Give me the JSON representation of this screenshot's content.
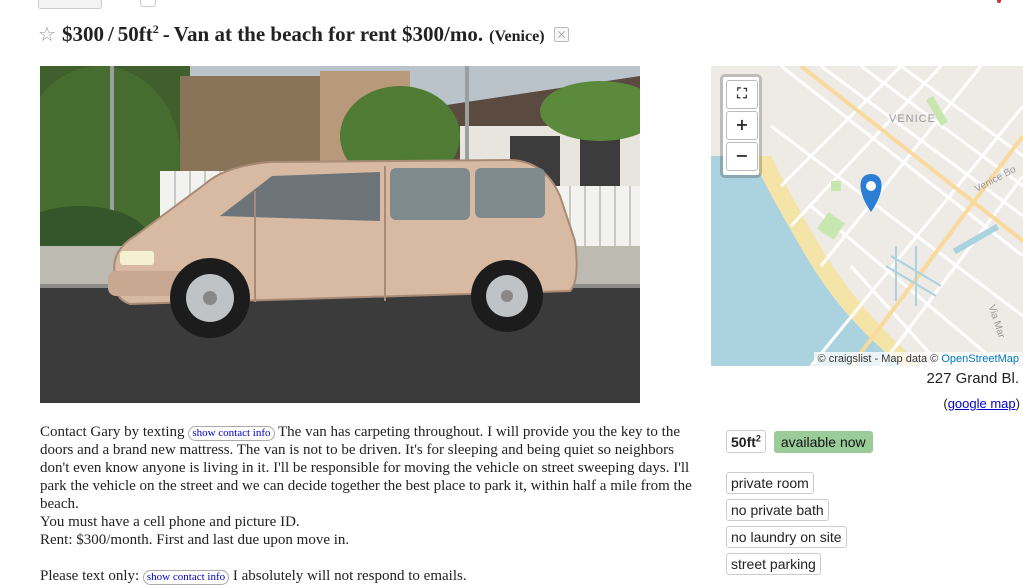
{
  "title": {
    "price": "$300",
    "separator": "/",
    "area_value": "50ft",
    "area_sup": "2",
    "dash": "-",
    "text": "Van at the beach for rent $300/mo.",
    "neighborhood": "(Venice)"
  },
  "map": {
    "area_label": "VENICE",
    "street_label_1": "Venice Bo",
    "street_label_2": "Via Mar",
    "fullscreen_label": "⛶",
    "zoom_in_label": "+",
    "zoom_out_label": "−",
    "attribution_prefix": "© craigslist - Map data ©",
    "attribution_link": "OpenStreetMap"
  },
  "address": {
    "street": "227 Grand Bl.",
    "map_link_open": "(",
    "map_link": "google map",
    "map_link_close": ")"
  },
  "attributes": {
    "area_value": "50ft",
    "area_sup": "2",
    "availability": "available now",
    "items": [
      "private room",
      "no private bath",
      "no laundry on site",
      "street parking"
    ]
  },
  "posting": {
    "contact_intro": "Contact Gary by texting",
    "contact_button": "show contact info",
    "para1_rest": "The van has carpeting throughout. I will provide you the key to the doors and a brand new mattress. The van is not to be driven. It's for sleeping and being quiet so neighbors don't even know anyone is living in it. I'll be responsible for moving the vehicle on street sweeping days. I'll park the vehicle on the street and we can decide together the best place to park it, within half a mile from the beach.",
    "line2": "You must have a cell phone and picture ID.",
    "line3": "Rent: $300/month. First and last due upon move in.",
    "text_only_intro": "Please text only:",
    "text_only_rest": "I absolutely will not respond to emails."
  },
  "colors": {
    "link": "#0000cc",
    "available_bg": "#99cc99",
    "map_pin": "#2a7fd4",
    "water": "#aad3df"
  }
}
